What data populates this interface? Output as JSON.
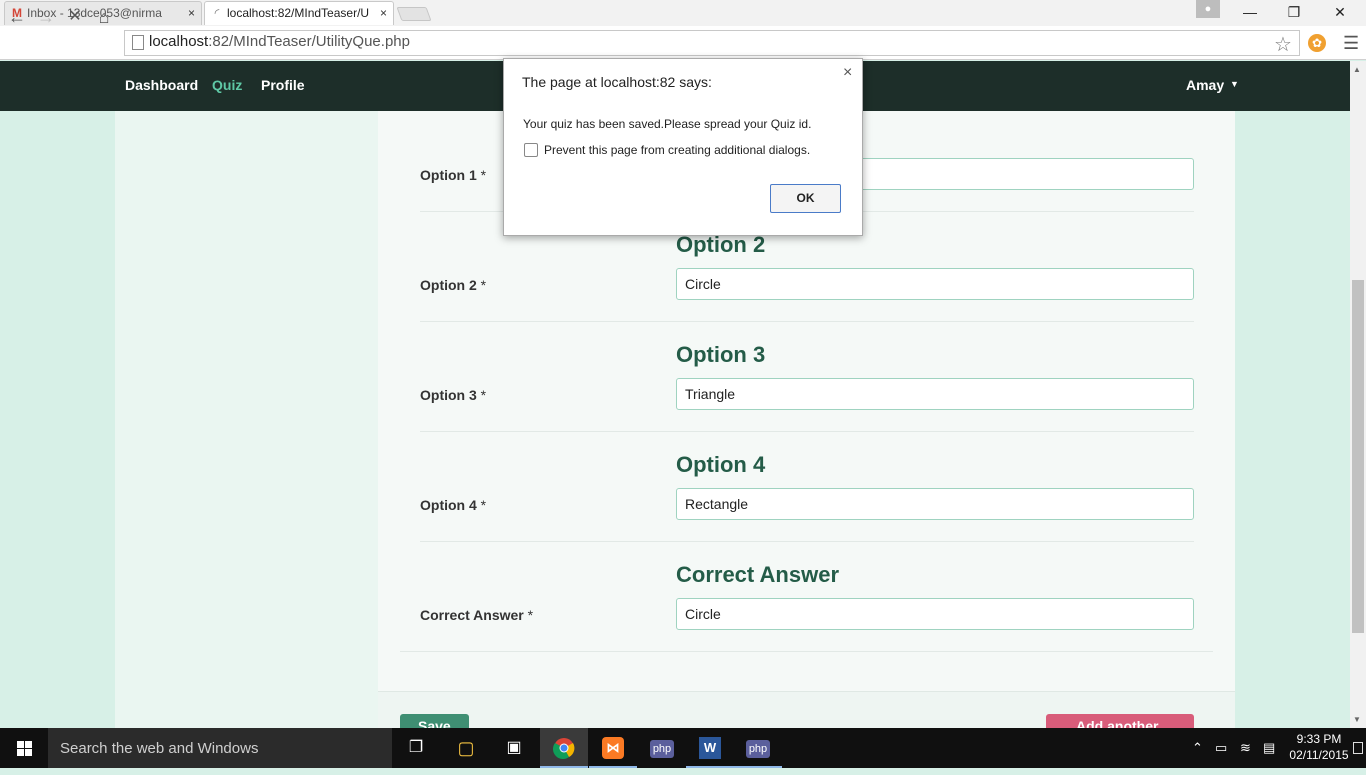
{
  "browser": {
    "tabs": [
      {
        "title": "Inbox - 13dce053@nirma",
        "icon": "gmail-icon",
        "close": "×"
      },
      {
        "title": "localhost:82/MIndTeaser/U",
        "icon": "loading-spinner-icon",
        "close": "×"
      }
    ],
    "window_controls": {
      "minimize": "—",
      "restore": "❐",
      "close": "✕"
    },
    "url_host": "localhost",
    "url_path": ":82/MIndTeaser/UtilityQue.php"
  },
  "navbar": {
    "items": [
      {
        "label": "Dashboard"
      },
      {
        "label": "Quiz"
      },
      {
        "label": "Profile"
      }
    ],
    "user": "Amay",
    "caret": "▼"
  },
  "form": {
    "rows": [
      {
        "label": "Option 1",
        "heading": "",
        "value": ""
      },
      {
        "label": "Option 2",
        "heading": "Option 2",
        "value": "Circle"
      },
      {
        "label": "Option 3",
        "heading": "Option 3",
        "value": "Triangle"
      },
      {
        "label": "Option 4",
        "heading": "Option 4",
        "value": "Rectangle"
      },
      {
        "label": "Correct Answer",
        "heading": "Correct Answer",
        "value": "Circle"
      }
    ],
    "required_mark": "*",
    "save_label": "Save",
    "add_label": "Add another"
  },
  "dialog": {
    "title": "The page at localhost:82 says:",
    "close": "×",
    "message": "Your quiz has been saved.Please spread your Quiz id.",
    "checkbox_label": "Prevent this page from creating additional dialogs.",
    "ok_label": "OK"
  },
  "taskbar": {
    "search_placeholder": "Search the web and Windows",
    "apps": [
      "task-view-icon",
      "file-explorer-icon",
      "store-icon",
      "chrome-icon",
      "xampp-icon",
      "php-icon",
      "word-icon",
      "php-designer-icon"
    ],
    "time": "9:33 PM",
    "date": "02/11/2015"
  },
  "colors": {
    "navbar_bg": "#1d2e29",
    "nav_active": "#5fc9a6",
    "heading": "#245c48",
    "input_border": "#9fd3c0",
    "page_bg": "#d7f0e7",
    "save_button": "#3f8f73",
    "add_button": "#d85c7a"
  }
}
